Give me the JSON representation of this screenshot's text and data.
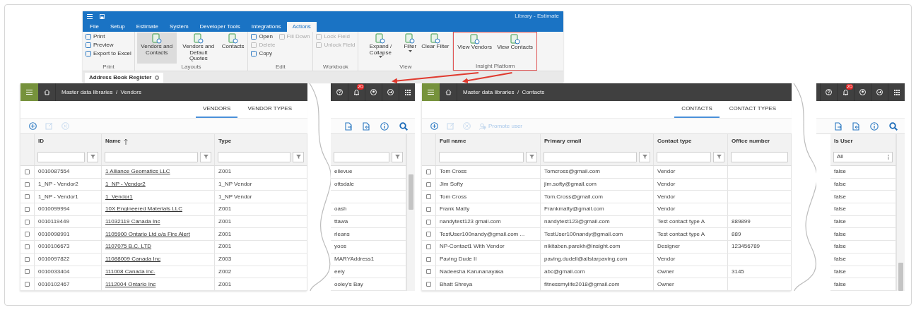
{
  "ribbon": {
    "title": "Library - Estimate",
    "tabs": [
      {
        "label": "File",
        "selected": false
      },
      {
        "label": "Setup",
        "selected": false
      },
      {
        "label": "Estimate",
        "selected": false
      },
      {
        "label": "System",
        "selected": false
      },
      {
        "label": "Developer Tools",
        "selected": false
      },
      {
        "label": "Integrations",
        "selected": false
      },
      {
        "label": "Actions",
        "selected": true
      }
    ],
    "groups": [
      {
        "label": "Print",
        "highlighted": false,
        "items": [
          {
            "kind": "small",
            "label": "Print",
            "disabled": false
          },
          {
            "kind": "small",
            "label": "Preview",
            "disabled": false
          },
          {
            "kind": "small",
            "label": "Export to Excel",
            "disabled": false
          }
        ]
      },
      {
        "label": "Layouts",
        "highlighted": false,
        "items": [
          {
            "kind": "large",
            "label": "Vendors and Contacts",
            "disabled": false,
            "selected": true
          },
          {
            "kind": "large",
            "label": "Vendors and Default Quotes",
            "disabled": false,
            "selected": false
          },
          {
            "kind": "large",
            "label": "Contacts",
            "disabled": false,
            "selected": false
          }
        ]
      },
      {
        "label": "Edit",
        "highlighted": false,
        "items": [
          {
            "kind": "small",
            "label": "Open",
            "disabled": false
          },
          {
            "kind": "small",
            "label": "Delete",
            "disabled": true
          },
          {
            "kind": "small",
            "label": "Copy",
            "disabled": false
          },
          {
            "kind": "small",
            "label": "Fill Down",
            "disabled": true
          }
        ]
      },
      {
        "label": "Workbook",
        "highlighted": false,
        "items": [
          {
            "kind": "small",
            "label": "Lock Field",
            "disabled": true
          },
          {
            "kind": "small",
            "label": "Unlock Field",
            "disabled": true
          }
        ]
      },
      {
        "label": "View",
        "highlighted": false,
        "items": [
          {
            "kind": "large",
            "label": "Expand / Collapse",
            "disabled": false,
            "dropdown": true
          },
          {
            "kind": "large",
            "label": "Filter",
            "disabled": false,
            "dropdown": true
          },
          {
            "kind": "large",
            "label": "Clear Filter",
            "disabled": false
          }
        ]
      },
      {
        "label": "Insight Platform",
        "highlighted": true,
        "items": [
          {
            "kind": "large",
            "label": "View Vendors",
            "disabled": false
          },
          {
            "kind": "large",
            "label": "View Contacts",
            "disabled": false
          }
        ]
      }
    ],
    "document_tabs": [
      {
        "label": "Address Book Register",
        "selected": true
      }
    ]
  },
  "panels": [
    {
      "breadcrumb": "Master data libraries  /  Vendors",
      "notification_count": "20",
      "tabs": [
        {
          "label": "VENDORS",
          "selected": true
        },
        {
          "label": "VENDOR TYPES",
          "selected": false
        }
      ],
      "toolbar": [
        {
          "kind": "add",
          "disabled": false
        },
        {
          "kind": "edit",
          "disabled": true
        },
        {
          "kind": "delete",
          "disabled": true
        }
      ],
      "side_toolbar": [
        {
          "kind": "export"
        },
        {
          "kind": "import"
        },
        {
          "kind": "info"
        },
        {
          "kind": "search"
        }
      ],
      "columns": [
        {
          "label": "ID",
          "kind": "text",
          "filter": {
            "kind": "text"
          }
        },
        {
          "label": "Name",
          "kind": "link",
          "sorted": true,
          "filter": {
            "kind": "text"
          }
        },
        {
          "label": "Type",
          "kind": "text",
          "filter": {
            "kind": "text"
          }
        }
      ],
      "side_columns": [
        {
          "kind": "text",
          "filter": {
            "kind": "text"
          }
        }
      ],
      "rows": [
        {
          "selected": false,
          "cells": [
            "0010087554",
            "1 Alliance Geomatics LLC",
            "Z001"
          ],
          "side_cells": [
            "ellevue"
          ]
        },
        {
          "selected": false,
          "cells": [
            "1_NP - Vendor2",
            "1_NP - Vendor2",
            "1_NP Vendor"
          ],
          "side_cells": [
            "ottsdale"
          ]
        },
        {
          "selected": false,
          "cells": [
            "1_NP - Vendor1",
            "1_Vendor1",
            "1_NP Vendor"
          ],
          "side_cells": [
            null
          ]
        },
        {
          "selected": false,
          "cells": [
            "0010099994",
            "10X Engineered Materials LLC",
            "Z001"
          ],
          "side_cells": [
            "oash"
          ]
        },
        {
          "selected": false,
          "cells": [
            "0010119449",
            "11032119 Canada Inc",
            "Z001"
          ],
          "side_cells": [
            "ttawa"
          ]
        },
        {
          "selected": false,
          "cells": [
            "0010098991",
            "1105900 Ontario Ltd o/a Fire Alert",
            "Z001"
          ],
          "side_cells": [
            "rleans"
          ]
        },
        {
          "selected": false,
          "cells": [
            "0010106673",
            "1107075 B.C. LTD",
            "Z001"
          ],
          "side_cells": [
            "yoos"
          ]
        },
        {
          "selected": false,
          "cells": [
            "0010097822",
            "11088009 Canada Inc",
            "Z003"
          ],
          "side_cells": [
            "MARYAddress1"
          ]
        },
        {
          "selected": false,
          "cells": [
            "0010033404",
            "111008 Canada inc.",
            "Z002"
          ],
          "side_cells": [
            "eely"
          ]
        },
        {
          "selected": false,
          "cells": [
            "0010102467",
            "1112004 Ontario Inc",
            "Z001"
          ],
          "side_cells": [
            "ooley's Bay"
          ]
        }
      ]
    },
    {
      "breadcrumb": "Master data libraries  /  Contacts",
      "notification_count": "20",
      "tabs": [
        {
          "label": "CONTACTS",
          "selected": true
        },
        {
          "label": "CONTACT TYPES",
          "selected": false
        }
      ],
      "toolbar": [
        {
          "kind": "add",
          "disabled": false
        },
        {
          "kind": "edit",
          "disabled": true
        },
        {
          "kind": "delete",
          "disabled": true
        },
        {
          "kind": "promote",
          "label": "Promote user",
          "disabled": true
        }
      ],
      "side_toolbar": [
        {
          "kind": "export"
        },
        {
          "kind": "import"
        },
        {
          "kind": "info"
        },
        {
          "kind": "search"
        }
      ],
      "columns": [
        {
          "label": "Full name",
          "kind": "text",
          "filter": {
            "kind": "text"
          }
        },
        {
          "label": "Primary email",
          "kind": "text",
          "filter": {
            "kind": "text"
          }
        },
        {
          "label": "Contact type",
          "kind": "text",
          "filter": {
            "kind": "text"
          }
        },
        {
          "label": "Office number",
          "kind": "text",
          "filter": {
            "kind": "field"
          }
        }
      ],
      "side_columns": [
        {
          "label": "Is User",
          "kind": "text",
          "filter": {
            "kind": "select",
            "value": "All"
          }
        }
      ],
      "rows": [
        {
          "selected": false,
          "cells": [
            "Tom Cross",
            "Tomcross@gmail.com",
            "Vendor",
            null
          ],
          "side_cells": [
            "false"
          ]
        },
        {
          "selected": false,
          "cells": [
            "Jim Softy",
            "jim.softy@gmail.com",
            "Vendor",
            null
          ],
          "side_cells": [
            "false"
          ]
        },
        {
          "selected": false,
          "cells": [
            "Tom Cross",
            "Tom.Cross@gmail.com",
            "Vendor",
            null
          ],
          "side_cells": [
            "false"
          ]
        },
        {
          "selected": false,
          "cells": [
            "Frank Matty",
            "Frankmatty@gmail.com",
            "Vendor",
            null
          ],
          "side_cells": [
            "false"
          ]
        },
        {
          "selected": false,
          "cells": [
            "nandytest123 gmail.com",
            "nandytest123@gmail.com",
            "Test contact type A",
            "889899"
          ],
          "side_cells": [
            "false"
          ]
        },
        {
          "selected": false,
          "cells": [
            "TestUser100nandy@gmail.com ...",
            "TestUser100nandy@gmail.com",
            "Test contact type A",
            "889"
          ],
          "side_cells": [
            "false"
          ]
        },
        {
          "selected": false,
          "cells": [
            "NP-Contact1 With Vendor",
            "nikitaben.parekh@insight.com",
            "Designer",
            "123456789"
          ],
          "side_cells": [
            "false"
          ]
        },
        {
          "selected": false,
          "cells": [
            "Paving Dude II",
            "paving.dudell@allstarpaving.com",
            "Vendor",
            null
          ],
          "side_cells": [
            "false"
          ]
        },
        {
          "selected": false,
          "cells": [
            "Nadeesha Karunanayaka",
            "abc@gmail.com",
            "Owner",
            "3145"
          ],
          "side_cells": [
            "false"
          ]
        },
        {
          "selected": false,
          "cells": [
            "Bhatt Shreya",
            "fitnessmylife2018@gmail.com",
            "Owner",
            null
          ],
          "side_cells": [
            "false"
          ]
        }
      ]
    }
  ]
}
